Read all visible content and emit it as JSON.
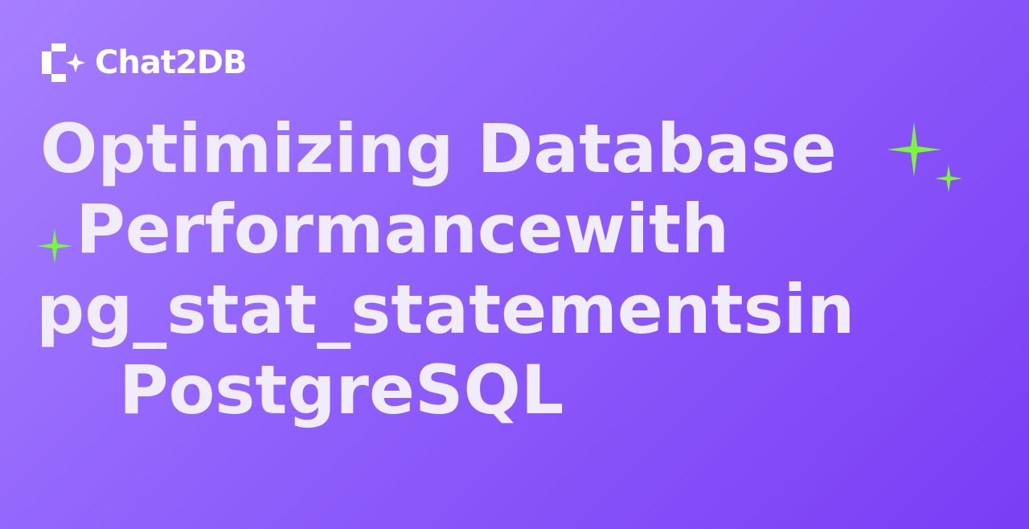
{
  "brand": {
    "name": "Chat2DB"
  },
  "title": {
    "lines": [
      "Optimizing Database",
      " Performancewith",
      "pg_stat_statementsin",
      "PostgreSQL"
    ]
  },
  "colors": {
    "accent": "#7cf53a",
    "text": "#f1ecfa"
  }
}
